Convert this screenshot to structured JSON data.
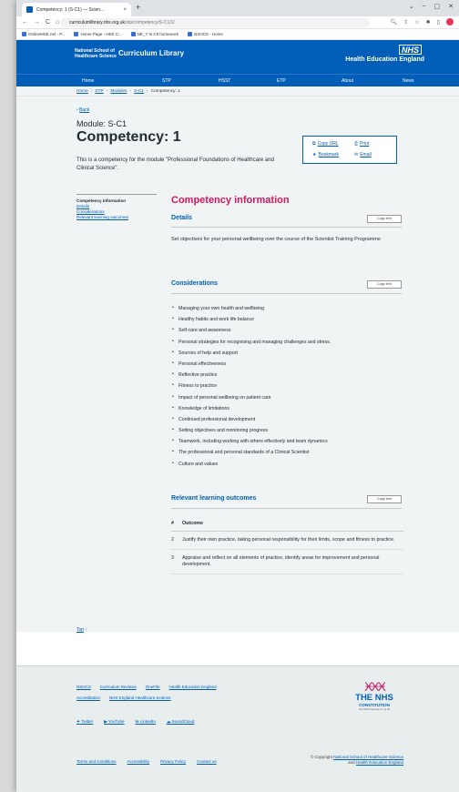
{
  "browser": {
    "tab_title": "Competency: 1 (S-C1) — Scien...",
    "tab_close": "×",
    "new_tab": "+",
    "window_controls": [
      "⌄",
      "–",
      "▢",
      "✕"
    ],
    "nav": [
      "←",
      "→",
      "C",
      "⌂"
    ],
    "url_host": "curriculumlibrary.nhs.org.uk",
    "url_path": "/stp/competency/S-C1/1/",
    "bookmarks": [
      "OnlineMSE.net - P...",
      "Home Page - HEE C...",
      "NE_Y ts C5 homework",
      "NSHCS - Home"
    ]
  },
  "header": {
    "org_line1": "National School of",
    "org_line2": "Healthcare Science",
    "library": "Curriculum Library",
    "nhs_logo": "NHS",
    "hee": "Health Education England"
  },
  "nav": {
    "items": [
      "Home",
      "STP",
      "HSST",
      "ETP",
      "About",
      "News"
    ]
  },
  "breadcrumb": {
    "items": [
      "Home",
      "STP",
      "Modules",
      "S-C1"
    ],
    "current": "Competency: 1"
  },
  "page": {
    "back": "Back",
    "module": "Module: S-C1",
    "title": "Competency: 1",
    "intro": "This is a competency for the module \"Professional Foundations of Healthcare and Clinical Science\".",
    "actions": {
      "copy_url": "Copy URL",
      "print": "Print",
      "bookmark": "Bookmark",
      "email": "Email"
    },
    "sidenav": {
      "active": "Competency information",
      "links": [
        "Details",
        "Considerations",
        "Relevant learning outcomes"
      ]
    },
    "heading": "Competency information",
    "copy_label": "Copy text",
    "details": {
      "heading": "Details",
      "text": "Set objectives for your personal wellbeing over the course of the Scientist Training Programme"
    },
    "considerations": {
      "heading": "Considerations",
      "items": [
        "Managing your own health and wellbeing",
        "Healthy habits and work life balance",
        "Self-care and awareness",
        "Personal strategies for recognising and managing challenges and stress.",
        "Sources of help and support",
        "Personal effectiveness",
        "Reflective practice",
        "Fitness to practice",
        "Impact of personal wellbeing on patient care",
        "Knowledge of limitations",
        "Continued professional development",
        "Setting objectives and monitoring progress",
        "Teamwork, including working with others effectively and team dynamics",
        "The professional and personal standards of a Clinical Scientist",
        "Culture and values"
      ]
    },
    "outcomes": {
      "heading": "Relevant learning outcomes",
      "col_num": "#",
      "col_outcome": "Outcome",
      "rows": [
        {
          "num": "2",
          "text": "Justify their own practice, taking personal responsibility for their limits, scope and fitness to practice."
        },
        {
          "num": "3",
          "text": "Appraise and reflect on all elements of practice, identify areas for improvement and personal development."
        }
      ]
    },
    "top": "Top"
  },
  "footer": {
    "links_row1": [
      "NSHCS",
      "Curriculum Reviews",
      "OneFile",
      "Health Education England"
    ],
    "links_row2": [
      "Accreditation",
      "NHS England Healthcare Science"
    ],
    "social": [
      "Twitter",
      "YouTube",
      "LinkedIn",
      "SoundCloud"
    ],
    "legal": [
      "Terms and Conditions",
      "Accessibility",
      "Privacy Policy",
      "Contact us"
    ],
    "copyright_prefix": "© Copyright",
    "copyright_org1": "National School of Healthcare Science",
    "copyright_and": "and",
    "copyright_org2": "Health Education England",
    "constitution_line1": "THE NHS",
    "constitution_line2": "CONSTITUTION",
    "constitution_line3": "the NHS belongs to us all"
  },
  "colors": {
    "nhs_blue": "#005eb8",
    "accent_pink": "#d5145a",
    "page_bg": "#f0f4f5"
  }
}
